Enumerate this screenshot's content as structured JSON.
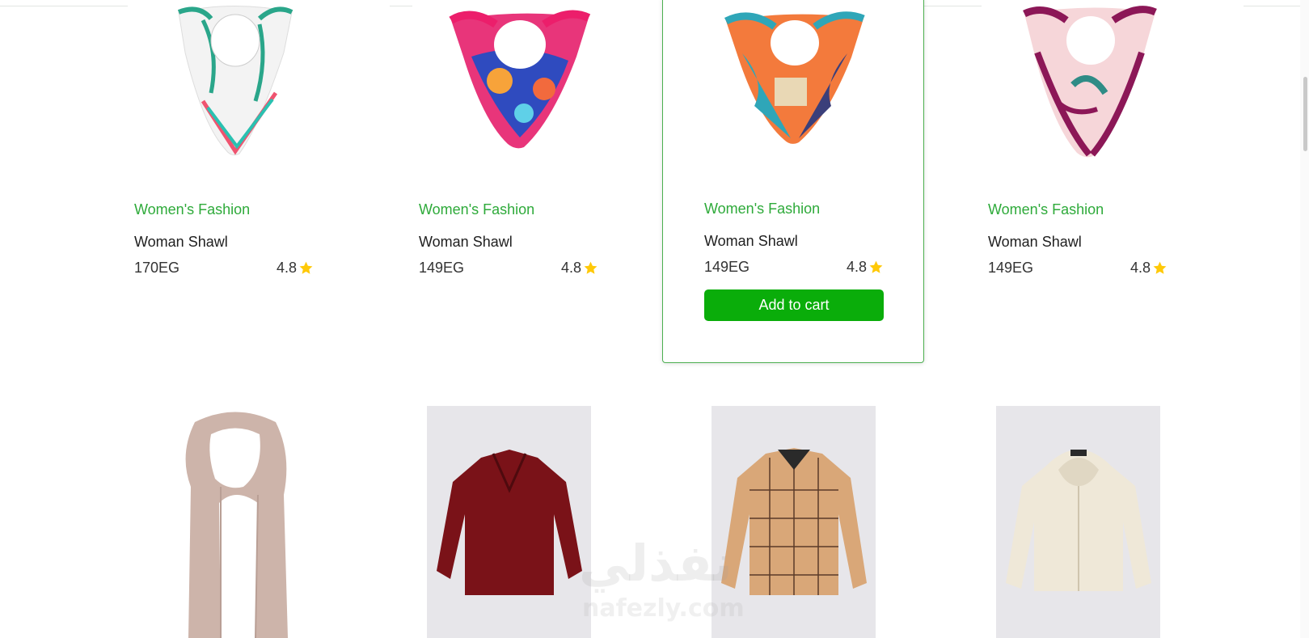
{
  "products_row1": [
    {
      "category": "Women's Fashion",
      "title": "Woman Shawl",
      "price": "170EG",
      "rating": "4.8",
      "image": "floral-white-shawl"
    },
    {
      "category": "Women's Fashion",
      "title": "Woman Shawl",
      "price": "149EG",
      "rating": "4.8",
      "image": "pink-blue-shawl"
    },
    {
      "category": "Women's Fashion",
      "title": "Woman Shawl",
      "price": "149EG",
      "rating": "4.8",
      "image": "orange-teal-shawl"
    },
    {
      "category": "Women's Fashion",
      "title": "Woman Shawl",
      "price": "149EG",
      "rating": "4.8",
      "image": "burgundy-floral-shawl"
    }
  ],
  "add_to_cart_label": "Add to cart",
  "products_row2": [
    {
      "image": "beige-scarf"
    },
    {
      "image": "burgundy-blouse"
    },
    {
      "image": "plaid-shirt"
    },
    {
      "image": "cream-hoodie"
    }
  ],
  "watermark": {
    "arabic": "نفذلي",
    "latin": "nafezly.com"
  },
  "colors": {
    "accent": "#0aad0a",
    "category": "#2eaa3a",
    "star": "#ffc908"
  }
}
